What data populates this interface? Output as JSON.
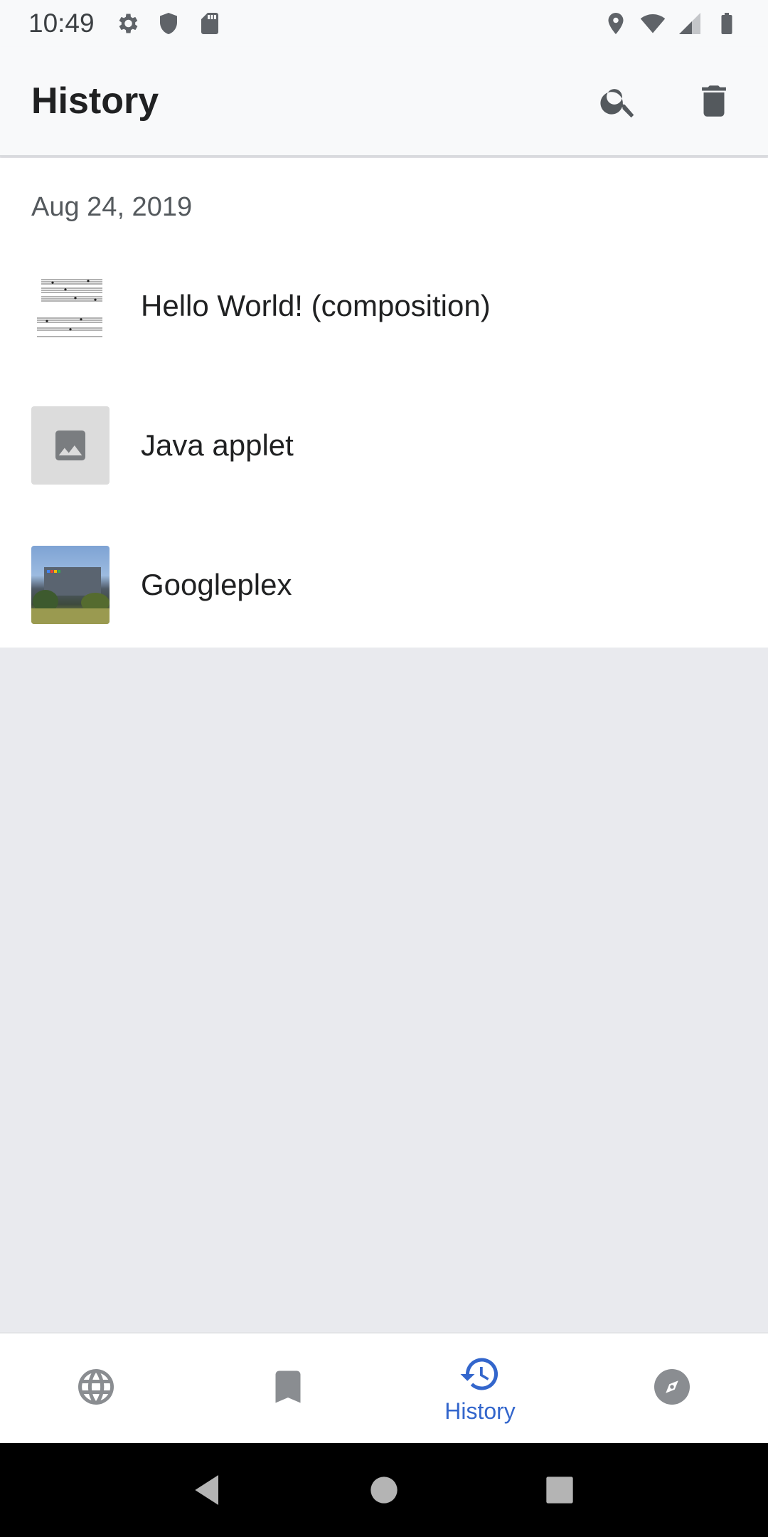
{
  "status_bar": {
    "time": "10:49",
    "left_icons": [
      "gear-icon",
      "shield-icon",
      "sd-card-icon"
    ],
    "right_icons": [
      "location-icon",
      "wifi-icon",
      "signal-icon",
      "battery-icon"
    ]
  },
  "app_bar": {
    "title": "History",
    "actions": [
      "search-icon",
      "trash-icon"
    ]
  },
  "history": {
    "date": "Aug 24, 2019",
    "items": [
      {
        "title": "Hello World! (composition)",
        "thumbnail": "sheet-music-thumbnail"
      },
      {
        "title": "Java applet",
        "thumbnail": "image-placeholder-icon"
      },
      {
        "title": "Googleplex",
        "thumbnail": "googleplex-photo"
      }
    ]
  },
  "bottom_nav": {
    "items": [
      {
        "icon": "globe-icon",
        "label": ""
      },
      {
        "icon": "bookmark-icon",
        "label": ""
      },
      {
        "icon": "history-icon",
        "label": "History",
        "active": true
      },
      {
        "icon": "compass-icon",
        "label": ""
      }
    ]
  },
  "colors": {
    "accent": "#3366cc",
    "app_bar_bg": "#f8f9fa",
    "content_bg": "#ffffff",
    "empty_bg": "#e9eaee"
  }
}
